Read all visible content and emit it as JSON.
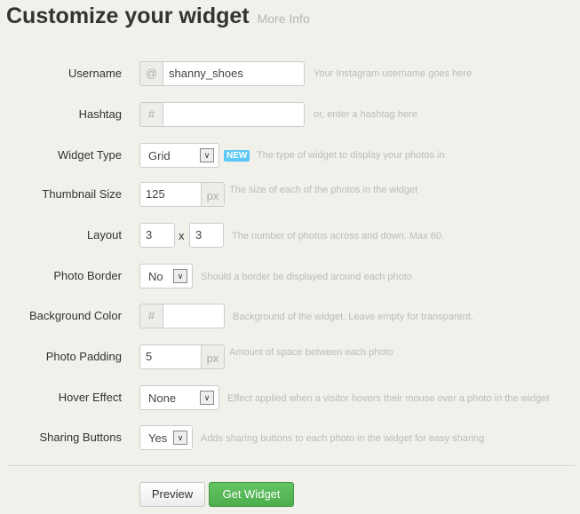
{
  "header": {
    "title": "Customize your widget",
    "more_info": "More Info"
  },
  "fields": {
    "username": {
      "label": "Username",
      "prefix": "@",
      "value": "shanny_shoes",
      "hint": "Your Instagram username goes here"
    },
    "hashtag": {
      "label": "Hashtag",
      "prefix": "#",
      "value": "",
      "hint": "or, enter a hashtag here"
    },
    "widget_type": {
      "label": "Widget Type",
      "value": "Grid",
      "badge": "NEW",
      "hint": "The type of widget to display your photos in"
    },
    "thumbnail_size": {
      "label": "Thumbnail Size",
      "value": "125",
      "suffix": "px",
      "hint": "The size of each of the photos in the widget"
    },
    "layout": {
      "label": "Layout",
      "cols": "3",
      "sep": "x",
      "rows": "3",
      "hint": "The number of photos across and down. Max 60."
    },
    "photo_border": {
      "label": "Photo Border",
      "value": "No",
      "hint": "Should a border be displayed around each photo"
    },
    "background_color": {
      "label": "Background Color",
      "prefix": "#",
      "value": "",
      "hint": "Background of the widget. Leave empty for transparent."
    },
    "photo_padding": {
      "label": "Photo Padding",
      "value": "5",
      "suffix": "px",
      "hint": "Amount of space between each photo"
    },
    "hover_effect": {
      "label": "Hover Effect",
      "value": "None",
      "hint": "Effect applied when a visitor hovers their mouse over a photo in the widget"
    },
    "sharing_buttons": {
      "label": "Sharing Buttons",
      "value": "Yes",
      "hint": "Adds sharing buttons to each photo in the widget for easy sharing"
    }
  },
  "actions": {
    "preview": "Preview",
    "get_widget": "Get Widget"
  },
  "colors": {
    "badge": "#5bc8f5",
    "primary": "#4cae4c"
  }
}
